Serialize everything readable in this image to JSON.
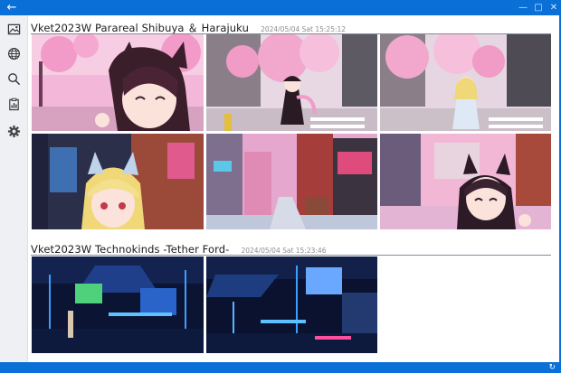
{
  "window": {
    "back_glyph": "←",
    "minimize_glyph": "—",
    "maximize_glyph": "□",
    "close_glyph": "✕",
    "refresh_glyph": "↻"
  },
  "sidebar": {
    "items": [
      {
        "name": "gallery",
        "icon": "image-icon"
      },
      {
        "name": "world",
        "icon": "globe-icon"
      },
      {
        "name": "search",
        "icon": "search-icon"
      },
      {
        "name": "report",
        "icon": "clipboard-chart-icon"
      },
      {
        "name": "settings",
        "icon": "gear-icon"
      }
    ]
  },
  "groups": [
    {
      "title": "Vket2023W Parareal Shibuya ＆ Harajuku",
      "timestamp": "2024/05/04 Sat 15:25:12",
      "photos": [
        {
          "scene": "pink sakura street, cat-ear avatar close-up selfie"
        },
        {
          "scene": "sakura street, avatar posing in crosswalk"
        },
        {
          "scene": "sakura street, blonde avatar at crosswalk"
        },
        {
          "scene": "alley, blonde avatar close-up"
        },
        {
          "scene": "neon alley with shop signs"
        },
        {
          "scene": "sweets shop storefront, avatar selfie"
        }
      ]
    },
    {
      "title": "Vket2023W Technokinds -Tether Ford-",
      "timestamp": "2024/05/04 Sat 15:23:46",
      "photos": [
        {
          "scene": "blue neon cyber hangar, avatar standing"
        },
        {
          "scene": "blue neon cyber hangar with screens"
        }
      ]
    }
  ]
}
